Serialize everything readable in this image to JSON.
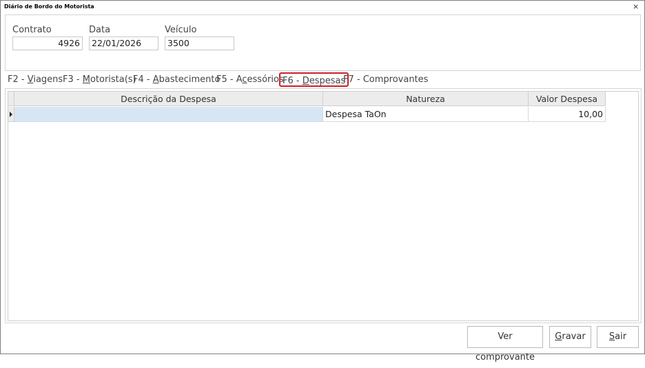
{
  "window": {
    "title": "Diário de Bordo do Motorista",
    "close_glyph": "×"
  },
  "header": {
    "contrato": {
      "label": "Contrato",
      "value": "4926"
    },
    "data": {
      "label": "Data",
      "value": "22/01/2026"
    },
    "veiculo": {
      "label": "Veículo",
      "value": "3500"
    }
  },
  "tabs": [
    {
      "prefix": "F2 - ",
      "mnemonic": "V",
      "rest": "iagens"
    },
    {
      "prefix": "F3 - ",
      "mnemonic": "M",
      "rest": "otorista(s)"
    },
    {
      "prefix": "F4 - ",
      "mnemonic": "A",
      "rest": "bastecimento"
    },
    {
      "prefix": "F5 - A",
      "mnemonic": "c",
      "rest": "essórios"
    },
    {
      "prefix": "F6 - ",
      "mnemonic": "D",
      "rest": "espesas",
      "active": true
    },
    {
      "prefix": "F7 - Comprovantes",
      "mnemonic": "",
      "rest": ""
    }
  ],
  "grid": {
    "columns": [
      "Descrição da Despesa",
      "Natureza",
      "Valor Despesa"
    ],
    "rows": [
      {
        "descricao": "",
        "natureza": "Despesa TaOn",
        "valor": "10,00"
      }
    ],
    "row_indicator_icon": "current-row-arrow-icon",
    "selected_cell_color": "#d6e6f5"
  },
  "buttons": {
    "ver_comprovante": "Ver comprovante",
    "gravar": {
      "mnemonic": "G",
      "rest": "ravar"
    },
    "sair": {
      "mnemonic": "S",
      "rest": "air"
    }
  },
  "colors": {
    "active_tab_border": "#cc1f2a"
  }
}
